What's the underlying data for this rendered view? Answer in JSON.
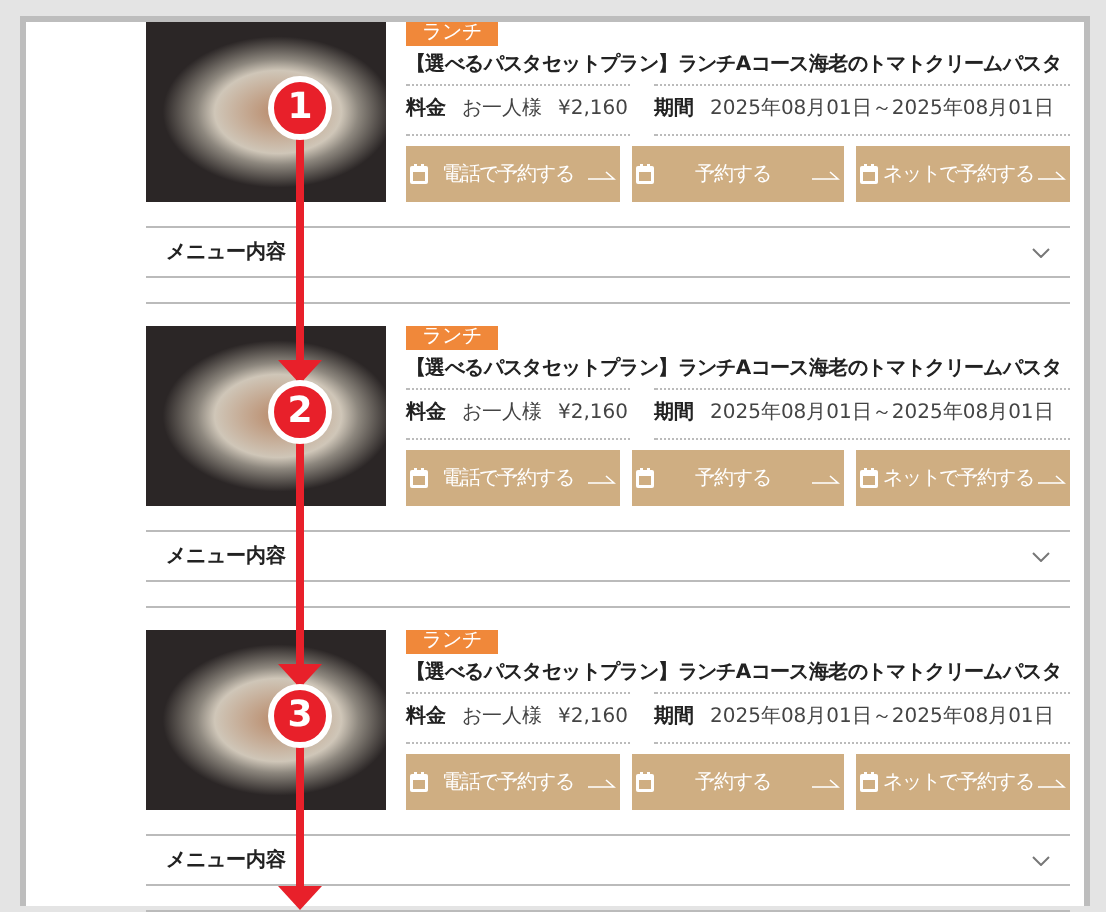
{
  "plans": [
    {
      "step": "1",
      "tag": "ランチ",
      "title": "【選べるパスタセットプラン】ランチAコース海老のトマトクリームパスタ",
      "price_label": "料金",
      "price_unit": "お一人様",
      "price_value": "¥2,160",
      "period_label": "期間",
      "period_value": "2025年08月01日～2025年08月01日",
      "buttons": [
        {
          "label": "電話で予約する"
        },
        {
          "label": "予約する"
        },
        {
          "label": "ネットで予約する"
        }
      ],
      "accordion": {
        "label": "メニュー内容",
        "expanded": false
      }
    },
    {
      "step": "2",
      "tag": "ランチ",
      "title": "【選べるパスタセットプラン】ランチAコース海老のトマトクリームパスタ",
      "price_label": "料金",
      "price_unit": "お一人様",
      "price_value": "¥2,160",
      "period_label": "期間",
      "period_value": "2025年08月01日～2025年08月01日",
      "buttons": [
        {
          "label": "電話で予約する"
        },
        {
          "label": "予約する"
        },
        {
          "label": "ネットで予約する"
        }
      ],
      "accordion": {
        "label": "メニュー内容",
        "expanded": false
      }
    },
    {
      "step": "3",
      "tag": "ランチ",
      "title": "【選べるパスタセットプラン】ランチAコース海老のトマトクリームパスタ",
      "price_label": "料金",
      "price_unit": "お一人様",
      "price_value": "¥2,160",
      "period_label": "期間",
      "period_value": "2025年08月01日～2025年08月01日",
      "buttons": [
        {
          "label": "電話で予約する"
        },
        {
          "label": "予約する"
        },
        {
          "label": "ネットで予約する"
        }
      ],
      "accordion": {
        "label": "メニュー内容",
        "expanded": false
      }
    }
  ]
}
